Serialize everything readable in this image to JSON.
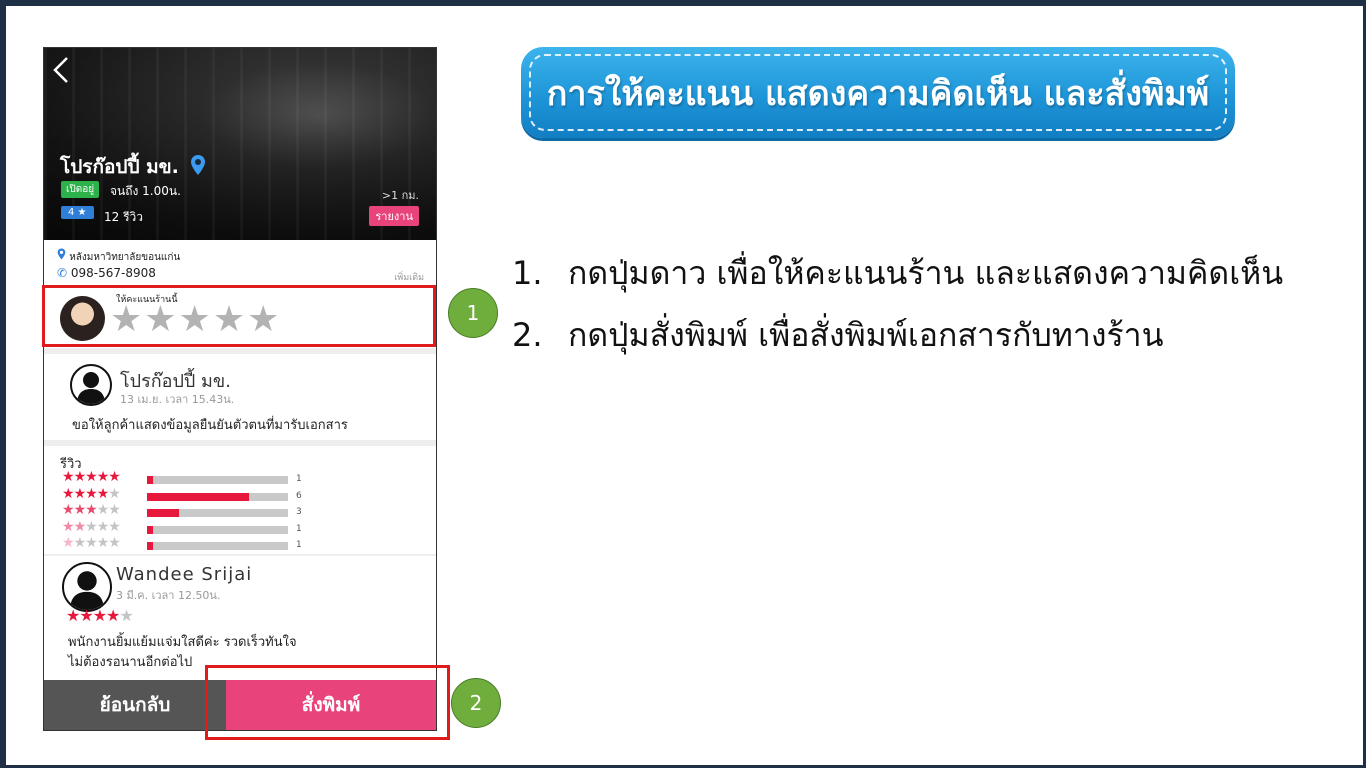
{
  "title": "การให้คะแนน แสดงความคิดเห็น และสั่งพิมพ์",
  "instructions": [
    {
      "num": "1.",
      "text": "กดปุ่มดาว เพื่อให้คะแนนร้าน และแสดงความคิดเห็น"
    },
    {
      "num": "2.",
      "text": "กดปุ่มสั่งพิมพ์ เพื่อสั่งพิมพ์เอกสารกับทางร้าน"
    }
  ],
  "markers": [
    "1",
    "2"
  ],
  "app": {
    "back_icon": "chevron-left-icon",
    "shop_name": "โปรก๊อปปี้ มข.",
    "open_badge": "เปิดอยู่",
    "open_until": "จนถึง 1.00น.",
    "rating_badge": "4 ★",
    "review_count": "12 รีวิว",
    "distance": ">1 กม.",
    "report": "รายงาน",
    "address": "หลังมหาวิทยาลัยขอนแก่น",
    "phone": "098-567-8908",
    "follow": "เพิ่มเติม",
    "rate_label": "ให้คะแนนร้านนี้",
    "rate_stars": "★★★★★",
    "post": {
      "author": "โปรก๊อปปี้ มข.",
      "time": "13 เม.ย. เวลา 15.43น.",
      "text": "ขอให้ลูกค้าแสดงข้อมูลยืนยันตัวตนที่มารับเอกสาร"
    },
    "reviews_title": "รีวิว",
    "review_breakdown": [
      {
        "stars": 5,
        "count": "1",
        "fraction": 0.04
      },
      {
        "stars": 4,
        "count": "6",
        "fraction": 0.72
      },
      {
        "stars": 3,
        "count": "3",
        "fraction": 0.23
      },
      {
        "stars": 2,
        "count": "1",
        "fraction": 0.04
      },
      {
        "stars": 1,
        "count": "1",
        "fraction": 0.04
      }
    ],
    "review": {
      "name": "Wandee Srijai",
      "time": "3 มี.ค. เวลา 12.50น.",
      "stars": 4,
      "line1": "พนักงานยิ้มแย้มแจ่มใสดีค่ะ รวดเร็วทันใจ",
      "line2": "ไม่ต้องรอนานอีกต่อไป"
    },
    "back_button": "ย้อนกลับ",
    "print_button": "สั่งพิมพ์"
  },
  "colors": {
    "accent_pink": "#e8437a",
    "star_red": "#e6193c",
    "open_green": "#2db14a",
    "rating_blue": "#2f7fd9",
    "banner_blue": "#1e95d8",
    "highlight_red": "#e01b1b",
    "marker_green": "#6fae3d"
  }
}
